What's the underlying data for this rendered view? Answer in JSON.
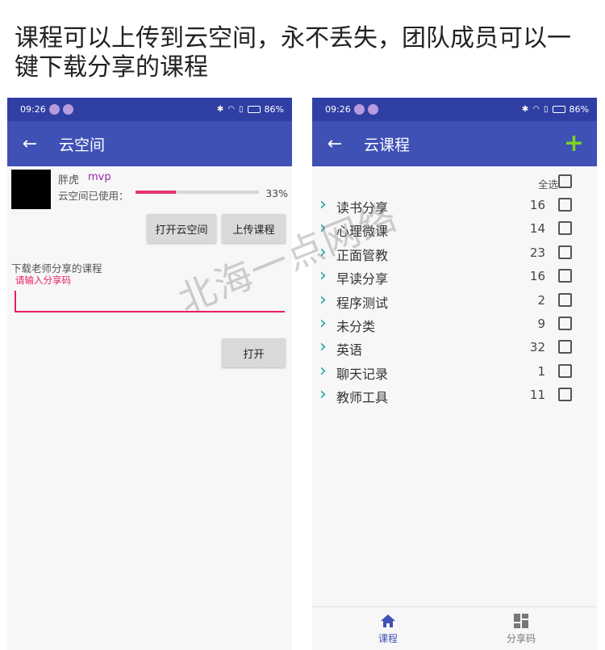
{
  "headline": "课程可以上传到云空间，永不丢失，团队成员可以一键下载分享的课程",
  "status_bar": {
    "time": "09:26",
    "battery": "86%"
  },
  "left_screen": {
    "title": "云空间",
    "user": {
      "name": "胖虎",
      "tag": "mvp"
    },
    "usage": {
      "label": "云空间已使用：",
      "percent_text": "33%",
      "percent_value": 33
    },
    "buttons": {
      "open_cloud": "打开云空间",
      "upload_course": "上传课程",
      "open": "打开"
    },
    "download": {
      "label": "下载老师分享的课程",
      "placeholder": "请输入分享码"
    }
  },
  "right_screen": {
    "title": "云课程",
    "select_all_label": "全选",
    "courses": [
      {
        "name": "读书分享",
        "count": "16"
      },
      {
        "name": "心理微课",
        "count": "14"
      },
      {
        "name": "正面管教",
        "count": "23"
      },
      {
        "name": "早读分享",
        "count": "16"
      },
      {
        "name": "程序测试",
        "count": "2"
      },
      {
        "name": "未分类",
        "count": "9"
      },
      {
        "name": "英语",
        "count": "32"
      },
      {
        "name": "聊天记录",
        "count": "1"
      },
      {
        "name": "教师工具",
        "count": "11"
      }
    ],
    "bottom_nav": [
      {
        "label": "课程",
        "icon": "home-icon",
        "active": true
      },
      {
        "label": "分享码",
        "icon": "grid-icon",
        "active": false
      }
    ]
  },
  "watermark": "北海一点网络",
  "colors": {
    "statusbar": "#2f3fa3",
    "appbar": "#3f51b5",
    "accent_pink": "#e91e63",
    "progress": "#e8336d",
    "tag_purple": "#9c27b0",
    "chevron_teal": "#1aa6a0",
    "plus_green": "#7ed321",
    "nav_active": "#3f51b5"
  }
}
